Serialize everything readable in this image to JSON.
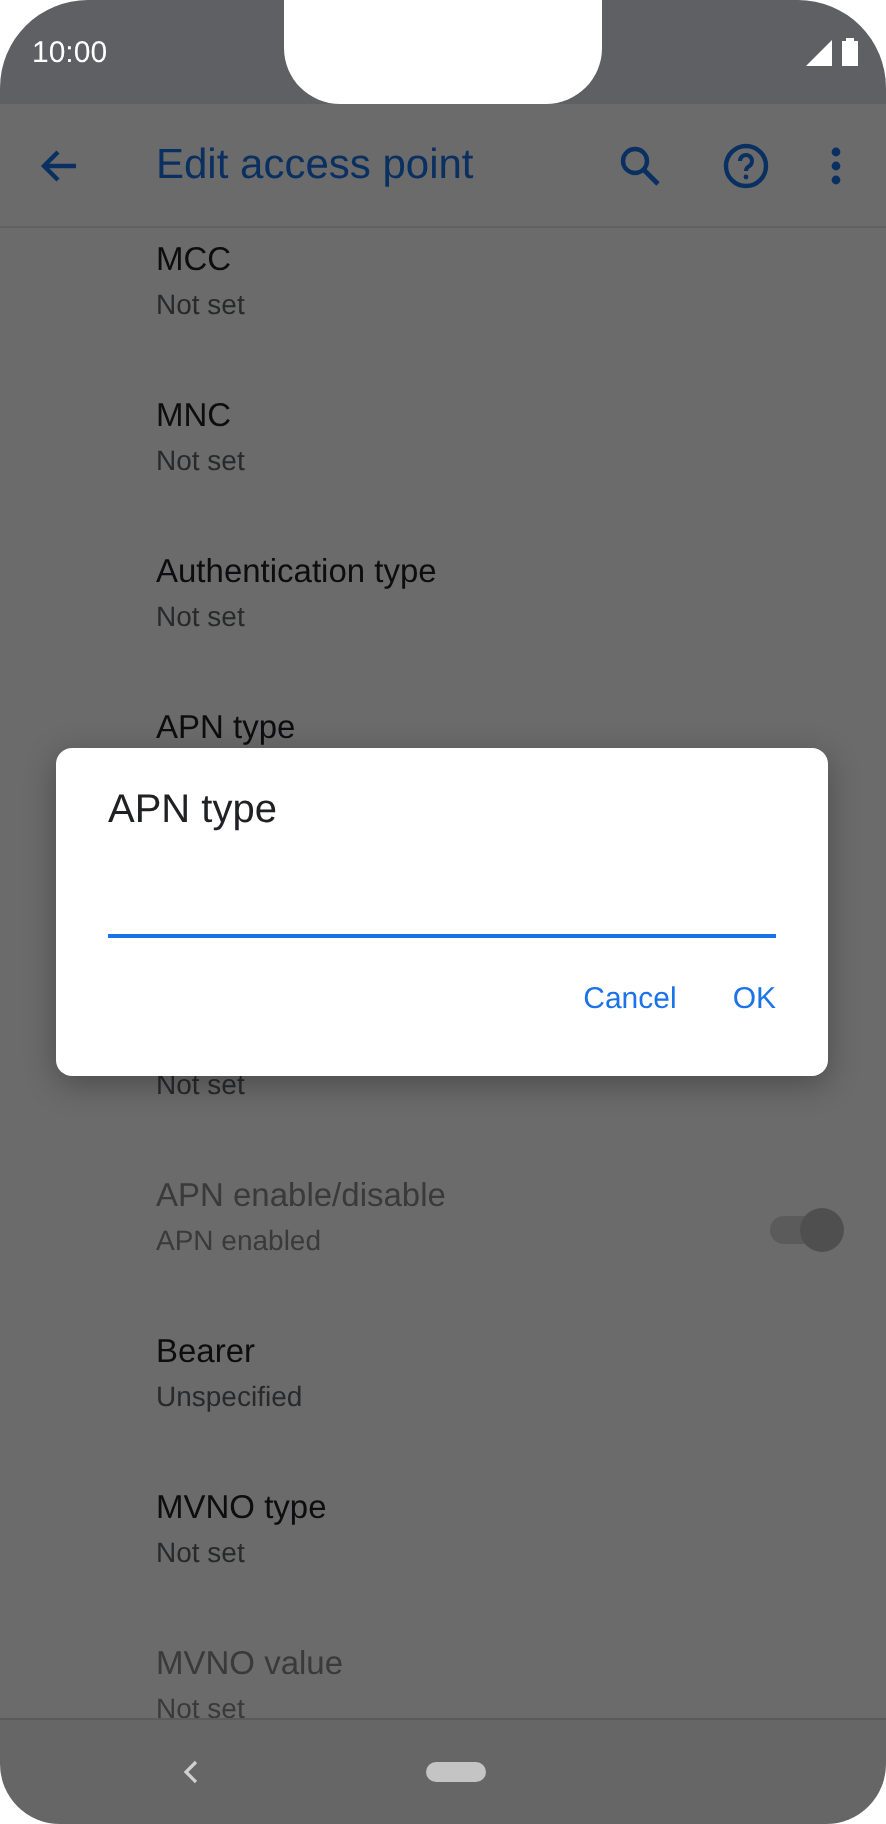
{
  "status_bar": {
    "time": "10:00"
  },
  "app_bar": {
    "title": "Edit access point"
  },
  "settings": [
    {
      "kind": "text",
      "title": "MCC",
      "summary": "Not set",
      "disabled": false
    },
    {
      "kind": "text",
      "title": "MNC",
      "summary": "Not set",
      "disabled": false
    },
    {
      "kind": "text",
      "title": "Authentication type",
      "summary": "Not set",
      "disabled": false
    },
    {
      "kind": "text",
      "title": "APN type",
      "disabled": false
    },
    {
      "kind": "text",
      "summary": "Not set",
      "disabled": false
    },
    {
      "kind": "switch",
      "title": "APN enable/disable",
      "summary": "APN enabled",
      "disabled": true,
      "on": true
    },
    {
      "kind": "text",
      "title": "Bearer",
      "summary": "Unspecified",
      "disabled": false
    },
    {
      "kind": "text",
      "title": "MVNO type",
      "summary": "Not set",
      "disabled": false
    },
    {
      "kind": "text",
      "title": "MVNO value",
      "summary": "Not set",
      "disabled": true
    }
  ],
  "dialog": {
    "title": "APN type",
    "buttons": [
      "Cancel",
      "OK"
    ]
  }
}
